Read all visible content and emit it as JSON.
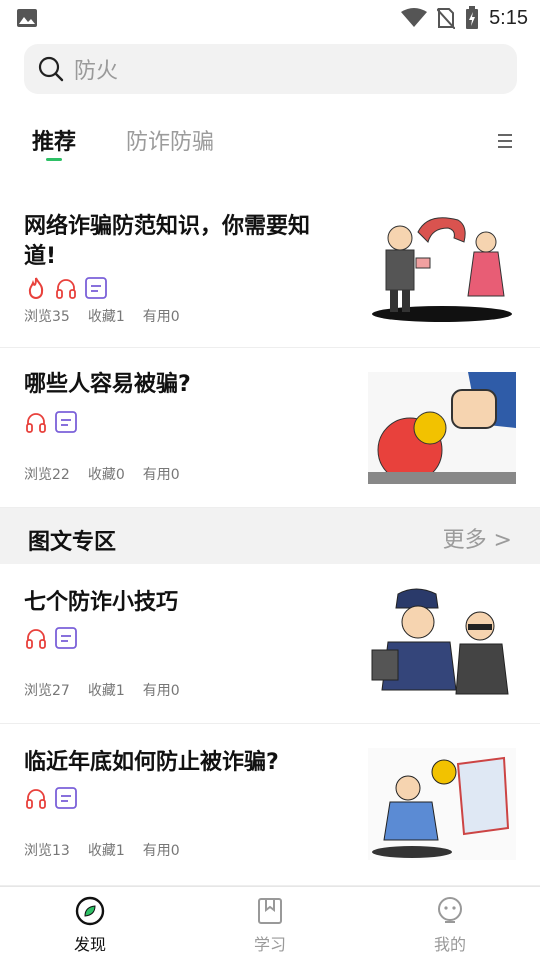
{
  "status_bar": {
    "time": "5:15"
  },
  "search": {
    "placeholder": "防火"
  },
  "tabs": [
    {
      "label": "推荐",
      "active": true
    },
    {
      "label": "防诈防骗",
      "active": false
    }
  ],
  "articles": [
    {
      "title": "网络诈骗防范知识，你需要知道!",
      "hot": true,
      "views": "浏览35",
      "collects": "收藏1",
      "useful": "有用0",
      "thumb": "phone-scam-cartoon"
    },
    {
      "title": "哪些人容易被骗?",
      "hot": false,
      "views": "浏览22",
      "collects": "收藏0",
      "useful": "有用0",
      "thumb": "fist-punching-scam-cartoon"
    }
  ],
  "section": {
    "title": "图文专区",
    "more": "更多 >"
  },
  "section_articles": [
    {
      "title": "七个防诈小技巧",
      "views": "浏览27",
      "collects": "收藏1",
      "useful": "有用0",
      "thumb": "police-arrest-cartoon"
    },
    {
      "title": "临近年底如何防止被诈骗?",
      "views": "浏览13",
      "collects": "收藏1",
      "useful": "有用0",
      "thumb": "atm-scam-cartoon"
    }
  ],
  "bottom_nav": [
    {
      "label": "发现",
      "icon": "compass-icon",
      "active": true
    },
    {
      "label": "学习",
      "icon": "bookmark-icon",
      "active": false
    },
    {
      "label": "我的",
      "icon": "profile-icon",
      "active": false
    }
  ],
  "colors": {
    "accent": "#2ec066",
    "hot": "#e8413c",
    "audio": "#e8413c",
    "doc": "#7b61d9"
  }
}
